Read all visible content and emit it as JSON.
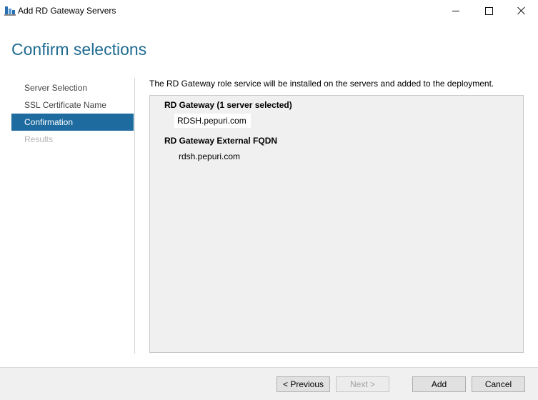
{
  "window": {
    "title": "Add RD Gateway Servers",
    "app_icon": "server-manager-icon",
    "controls": [
      "minimize-icon",
      "maximize-icon",
      "close-icon"
    ]
  },
  "page": {
    "title": "Confirm selections"
  },
  "nav": {
    "items": [
      {
        "label": "Server Selection",
        "state": "normal"
      },
      {
        "label": "SSL Certificate Name",
        "state": "normal"
      },
      {
        "label": "Confirmation",
        "state": "active"
      },
      {
        "label": "Results",
        "state": "disabled"
      }
    ]
  },
  "main": {
    "description": "The RD Gateway role service will be installed on the servers and added to the deployment.",
    "sections": [
      {
        "heading": "RD Gateway  (1 server selected)",
        "value": "RDSH.pepuri.com"
      },
      {
        "heading": "RD Gateway External FQDN",
        "value": "rdsh.pepuri.com"
      }
    ]
  },
  "footer": {
    "previous_label": "< Previous",
    "next_label": "Next >",
    "add_label": "Add",
    "cancel_label": "Cancel"
  },
  "colors": {
    "accent": "#1e6ba0",
    "title": "#1f6b91"
  }
}
